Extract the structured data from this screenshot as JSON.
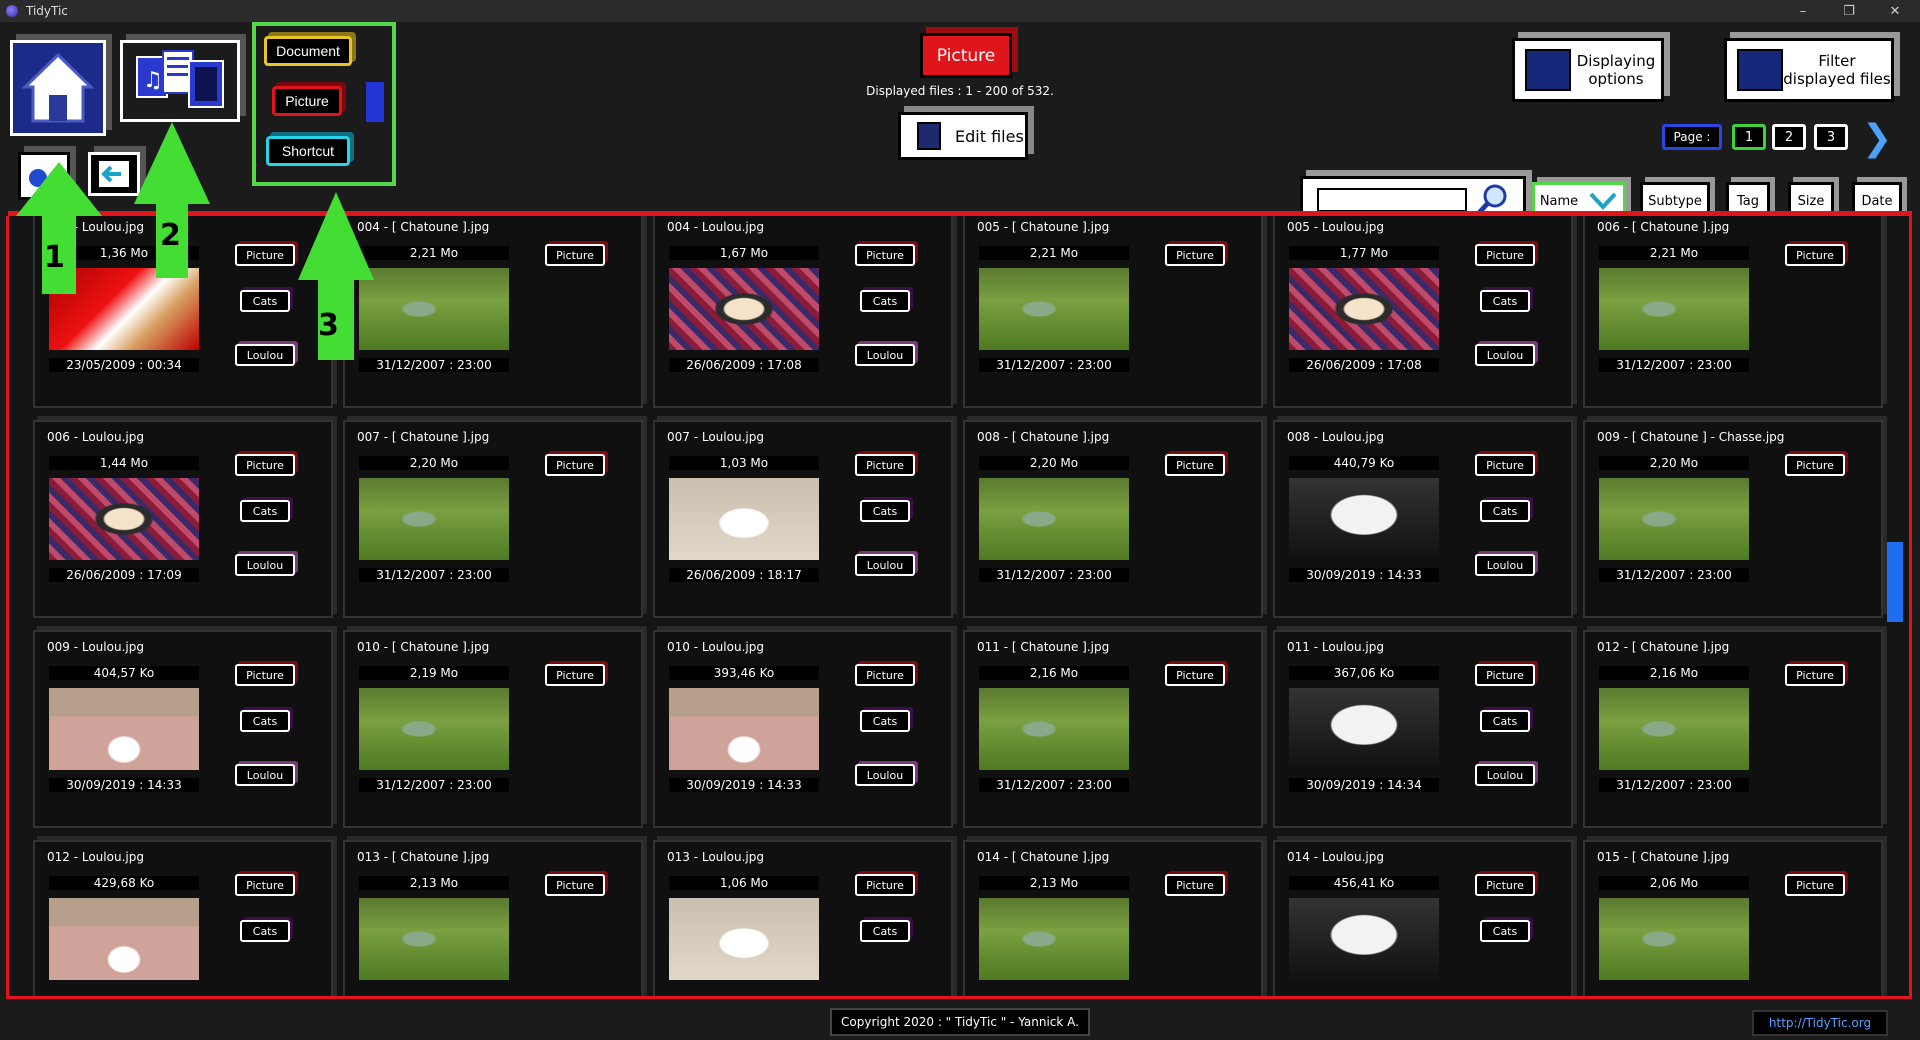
{
  "window": {
    "title": "TidyTic",
    "minimize": "–",
    "restore": "❐",
    "close": "✕"
  },
  "nav": {
    "home_icon": "home-icon",
    "media_icon": "media-files-icon",
    "back_icon": "back-arrow-icon"
  },
  "type_filter": {
    "document": "Document",
    "picture": "Picture",
    "shortcut": "Shortcut"
  },
  "annotations": {
    "n1": "1",
    "n2": "2",
    "n3": "3",
    "arrow_color": "#44dd33"
  },
  "header": {
    "current_type": "Picture",
    "displayed_files": "Displayed files : 1 - 200 of 532.",
    "edit_files": "Edit files",
    "displaying_options_1": "Displaying",
    "displaying_options_2": "options",
    "filter_1": "Filter",
    "filter_2": "displayed files"
  },
  "pagination": {
    "label": "Page :",
    "pages": [
      "1",
      "2",
      "3"
    ],
    "next": "❯"
  },
  "sort": {
    "name": "Name",
    "subtype": "Subtype",
    "tag": "Tag",
    "size": "Size",
    "date": "Date"
  },
  "search": {
    "placeholder": ""
  },
  "files": [
    {
      "name": "003 - Loulou.jpg",
      "size": "1,36 Mo",
      "date": "23/05/2009 : 00:34",
      "tags": [
        "Picture",
        "Cats",
        "Loulou"
      ],
      "thumb": "red"
    },
    {
      "name": "004 - [ Chatoune ].jpg",
      "size": "2,21 Mo",
      "date": "31/12/2007 : 23:00",
      "tags": [
        "Picture"
      ],
      "thumb": "grass"
    },
    {
      "name": "004 - Loulou.jpg",
      "size": "1,67 Mo",
      "date": "26/06/2009 : 17:08",
      "tags": [
        "Picture",
        "Cats",
        "Loulou"
      ],
      "thumb": "rug"
    },
    {
      "name": "005 - [ Chatoune ].jpg",
      "size": "2,21 Mo",
      "date": "31/12/2007 : 23:00",
      "tags": [
        "Picture"
      ],
      "thumb": "grass"
    },
    {
      "name": "005 - Loulou.jpg",
      "size": "1,77 Mo",
      "date": "26/06/2009 : 17:08",
      "tags": [
        "Picture",
        "Cats",
        "Loulou"
      ],
      "thumb": "rug"
    },
    {
      "name": "006 - [ Chatoune ].jpg",
      "size": "2,21 Mo",
      "date": "31/12/2007 : 23:00",
      "tags": [
        "Picture"
      ],
      "thumb": "grass"
    },
    {
      "name": "006 - Loulou.jpg",
      "size": "1,44 Mo",
      "date": "26/06/2009 : 17:09",
      "tags": [
        "Picture",
        "Cats",
        "Loulou"
      ],
      "thumb": "rug"
    },
    {
      "name": "007 - [ Chatoune ].jpg",
      "size": "2,20 Mo",
      "date": "31/12/2007 : 23:00",
      "tags": [
        "Picture"
      ],
      "thumb": "grass"
    },
    {
      "name": "007 - Loulou.jpg",
      "size": "1,03 Mo",
      "date": "26/06/2009 : 18:17",
      "tags": [
        "Picture",
        "Cats",
        "Loulou"
      ],
      "thumb": "floor"
    },
    {
      "name": "008 - [ Chatoune ].jpg",
      "size": "2,20 Mo",
      "date": "31/12/2007 : 23:00",
      "tags": [
        "Picture"
      ],
      "thumb": "grass"
    },
    {
      "name": "008 - Loulou.jpg",
      "size": "440,79 Ko",
      "date": "30/09/2019 : 14:33",
      "tags": [
        "Picture",
        "Cats",
        "Loulou"
      ],
      "thumb": "white"
    },
    {
      "name": "009 - [ Chatoune ] - Chasse.jpg",
      "size": "2,20 Mo",
      "date": "31/12/2007 : 23:00",
      "tags": [
        "Picture"
      ],
      "thumb": "grass"
    },
    {
      "name": "009 - Loulou.jpg",
      "size": "404,57 Ko",
      "date": "30/09/2019 : 14:33",
      "tags": [
        "Picture",
        "Cats",
        "Loulou"
      ],
      "thumb": "bed"
    },
    {
      "name": "010 - [ Chatoune ].jpg",
      "size": "2,19 Mo",
      "date": "31/12/2007 : 23:00",
      "tags": [
        "Picture"
      ],
      "thumb": "grass"
    },
    {
      "name": "010 - Loulou.jpg",
      "size": "393,46 Ko",
      "date": "30/09/2019 : 14:33",
      "tags": [
        "Picture",
        "Cats",
        "Loulou"
      ],
      "thumb": "bed"
    },
    {
      "name": "011 - [ Chatoune ].jpg",
      "size": "2,16 Mo",
      "date": "31/12/2007 : 23:00",
      "tags": [
        "Picture"
      ],
      "thumb": "grass"
    },
    {
      "name": "011 - Loulou.jpg",
      "size": "367,06 Ko",
      "date": "30/09/2019 : 14:34",
      "tags": [
        "Picture",
        "Cats",
        "Loulou"
      ],
      "thumb": "white"
    },
    {
      "name": "012 - [ Chatoune ].jpg",
      "size": "2,16 Mo",
      "date": "31/12/2007 : 23:00",
      "tags": [
        "Picture"
      ],
      "thumb": "grass"
    },
    {
      "name": "012 - Loulou.jpg",
      "size": "429,68 Ko",
      "date": "",
      "tags": [
        "Picture",
        "Cats"
      ],
      "thumb": "bed"
    },
    {
      "name": "013 - [ Chatoune ].jpg",
      "size": "2,13 Mo",
      "date": "",
      "tags": [
        "Picture"
      ],
      "thumb": "grass"
    },
    {
      "name": "013 - Loulou.jpg",
      "size": "1,06 Mo",
      "date": "",
      "tags": [
        "Picture",
        "Cats"
      ],
      "thumb": "floor"
    },
    {
      "name": "014 - [ Chatoune ].jpg",
      "size": "2,13 Mo",
      "date": "",
      "tags": [
        "Picture"
      ],
      "thumb": "grass"
    },
    {
      "name": "014 - Loulou.jpg",
      "size": "456,41 Ko",
      "date": "",
      "tags": [
        "Picture",
        "Cats"
      ],
      "thumb": "white"
    },
    {
      "name": "015 - [ Chatoune ].jpg",
      "size": "2,06 Mo",
      "date": "",
      "tags": [
        "Picture"
      ],
      "thumb": "grass"
    }
  ],
  "footer": {
    "copyright": "Copyright 2020 : \" TidyTic \" - Yannick A.",
    "link": "http://TidyTic.org"
  }
}
